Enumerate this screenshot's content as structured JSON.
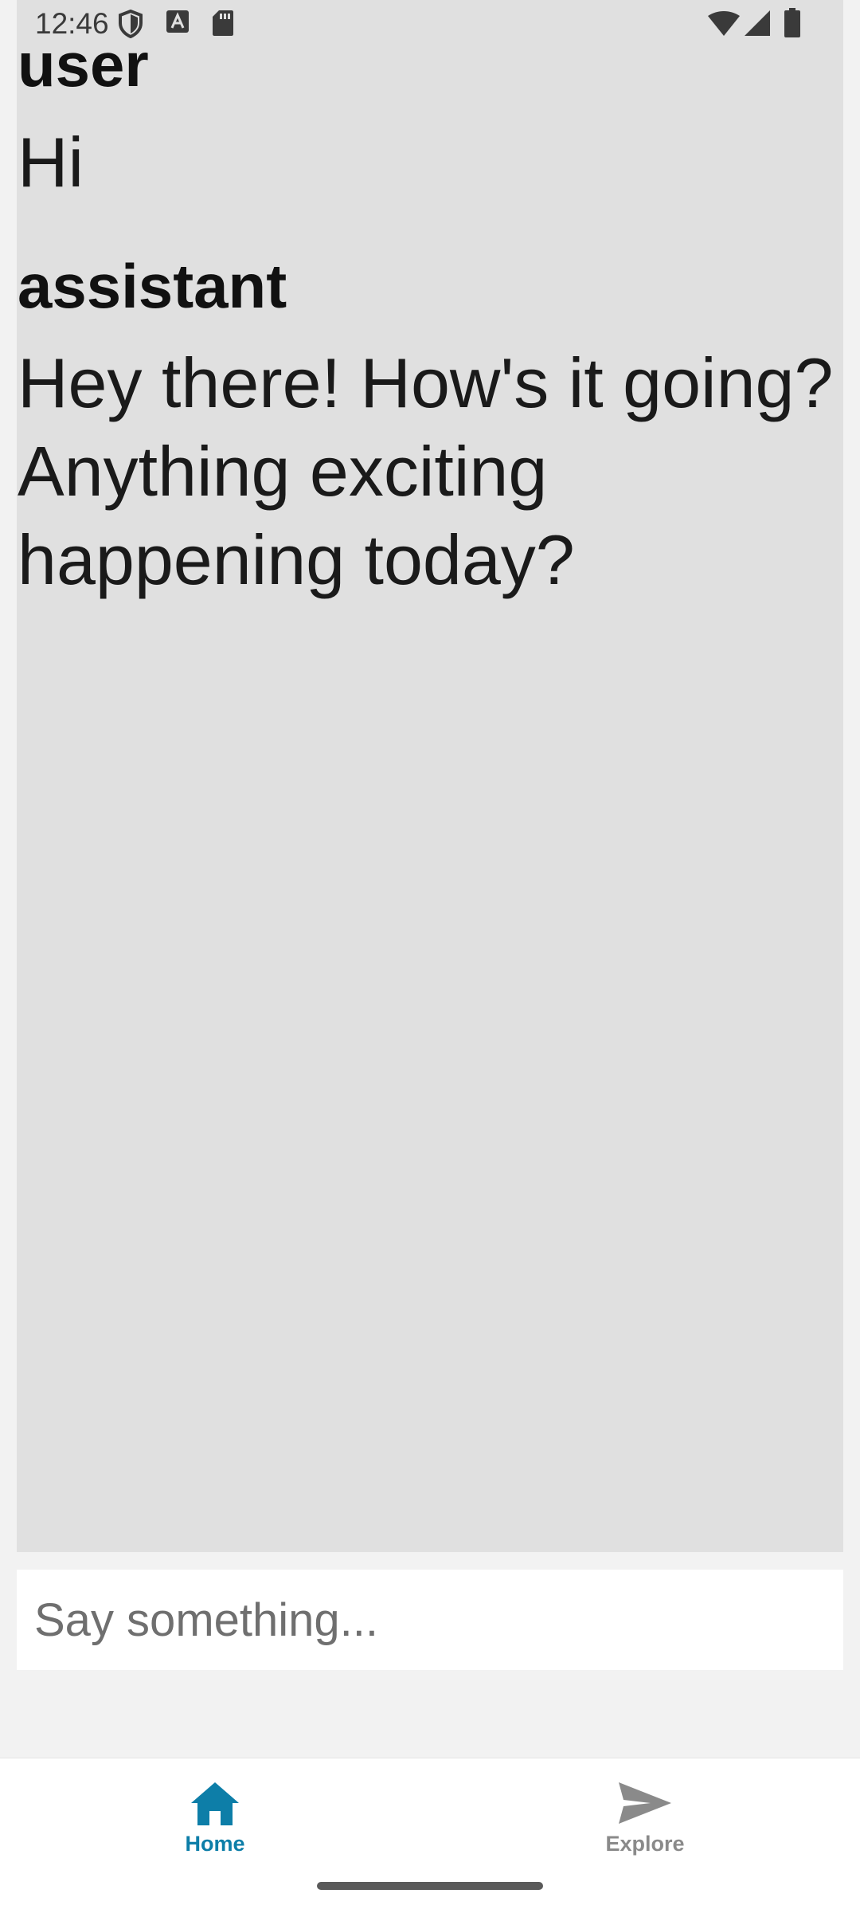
{
  "status_bar": {
    "time": "12:46",
    "left_icons": [
      "shield-icon",
      "text-a-icon",
      "sd-card-icon"
    ],
    "right_icons": [
      "wifi-icon",
      "cell-signal-icon",
      "battery-icon"
    ]
  },
  "chat": {
    "messages": [
      {
        "role": "user",
        "text": "Hi"
      },
      {
        "role": "assistant",
        "text": "Hey there! How's it going? Anything exciting happening today?"
      }
    ]
  },
  "input": {
    "value": "",
    "placeholder": "Say something..."
  },
  "bottom_nav": {
    "items": [
      {
        "label": "Home",
        "icon": "home-icon",
        "active": true
      },
      {
        "label": "Explore",
        "icon": "send-icon",
        "active": false
      }
    ]
  },
  "colors": {
    "accent": "#0d7ea8",
    "inactive": "#8a8a8a",
    "chat_background": "#e0e0e0",
    "page_background": "#f2f2f2"
  }
}
